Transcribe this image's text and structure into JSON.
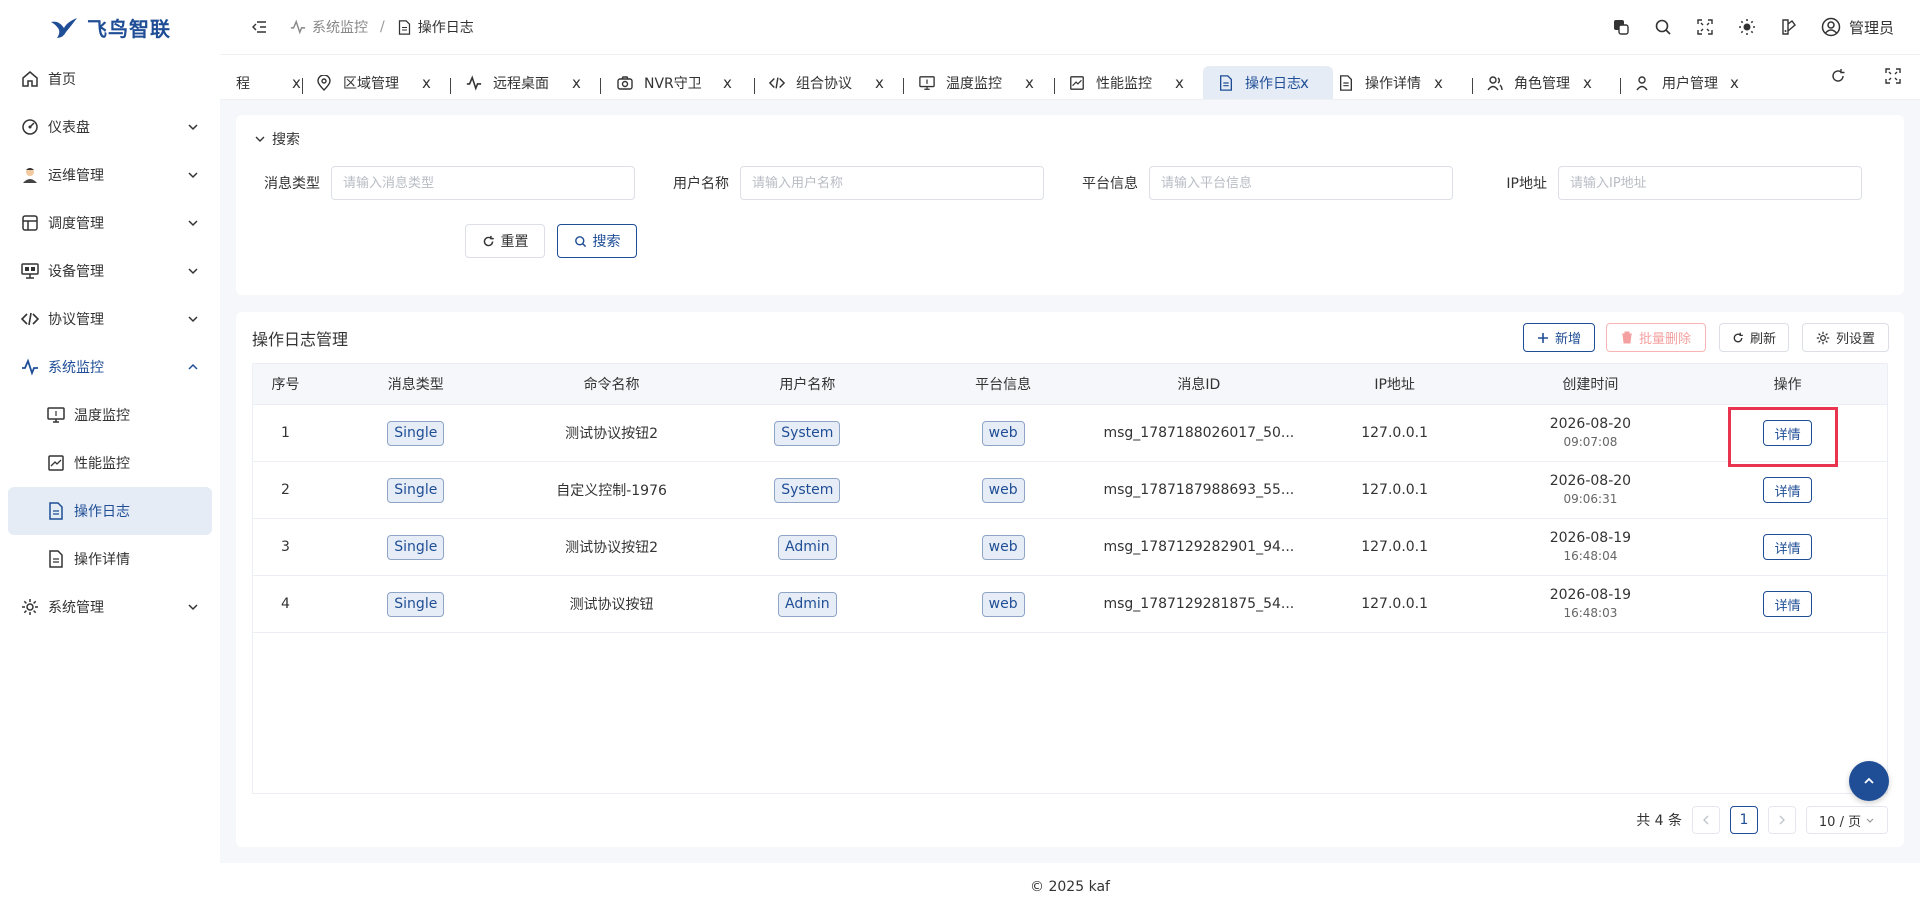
{
  "app": {
    "logo_text": "飞鸟智联",
    "brand_color": "#1f4e96"
  },
  "sidebar": {
    "items": [
      {
        "label": "首页",
        "icon": "home-icon"
      },
      {
        "label": "仪表盘",
        "icon": "dashboard-icon"
      },
      {
        "label": "运维管理",
        "icon": "engineer-avatar-icon"
      },
      {
        "label": "调度管理",
        "icon": "schedule-icon"
      },
      {
        "label": "设备管理",
        "icon": "device-icon"
      },
      {
        "label": "协议管理",
        "icon": "code-icon"
      },
      {
        "label": "系统监控",
        "icon": "pulse-icon",
        "open": true
      },
      {
        "label": "系统管理",
        "icon": "gear-icon"
      }
    ],
    "sub_items": [
      {
        "label": "温度监控",
        "icon": "monitor-icon"
      },
      {
        "label": "性能监控",
        "icon": "chart-icon"
      },
      {
        "label": "操作日志",
        "icon": "document-icon",
        "active": true
      },
      {
        "label": "操作详情",
        "icon": "document-icon"
      }
    ]
  },
  "header": {
    "breadcrumb": [
      "系统监控",
      "操作日志"
    ],
    "user_name": "管理员"
  },
  "tabs": [
    {
      "label": "程",
      "icon": ""
    },
    {
      "label": "区域管理",
      "icon": "location-icon"
    },
    {
      "label": "远程桌面",
      "icon": "pulse-icon"
    },
    {
      "label": "NVR守卫",
      "icon": "camera-icon"
    },
    {
      "label": "组合协议",
      "icon": "code-icon"
    },
    {
      "label": "温度监控",
      "icon": "monitor-icon"
    },
    {
      "label": "性能监控",
      "icon": "chart-icon"
    },
    {
      "label": "操作日志",
      "icon": "document-icon",
      "active": true
    },
    {
      "label": "操作详情",
      "icon": "document-icon"
    },
    {
      "label": "角色管理",
      "icon": "users-icon"
    },
    {
      "label": "用户管理",
      "icon": "user-icon"
    }
  ],
  "tab_close": "x",
  "search": {
    "title": "搜索",
    "fields": [
      {
        "label": "消息类型",
        "placeholder": "请输入消息类型"
      },
      {
        "label": "用户名称",
        "placeholder": "请输入用户名称"
      },
      {
        "label": "平台信息",
        "placeholder": "请输入平台信息"
      },
      {
        "label": "IP地址",
        "placeholder": "请输入IP地址"
      }
    ],
    "reset_label": "重置",
    "search_label": "搜索"
  },
  "table_card": {
    "title": "操作日志管理",
    "add_label": "新增",
    "batch_delete_label": "批量删除",
    "refresh_label": "刷新",
    "columns_label": "列设置"
  },
  "table": {
    "headers": [
      "序号",
      "消息类型",
      "命令名称",
      "用户名称",
      "平台信息",
      "消息ID",
      "IP地址",
      "创建时间",
      "操作"
    ],
    "rows": [
      {
        "index": "1",
        "type": "Single",
        "command": "测试协议按钮2",
        "user": "System",
        "platform": "web",
        "msg_id": "msg_1787188026017_50...",
        "ip": "127.0.0.1",
        "date": "2026-08-20",
        "time": "09:07:08",
        "action": "详情"
      },
      {
        "index": "2",
        "type": "Single",
        "command": "自定义控制-1976",
        "user": "System",
        "platform": "web",
        "msg_id": "msg_1787187988693_55...",
        "ip": "127.0.0.1",
        "date": "2026-08-20",
        "time": "09:06:31",
        "action": "详情"
      },
      {
        "index": "3",
        "type": "Single",
        "command": "测试协议按钮2",
        "user": "Admin",
        "platform": "web",
        "msg_id": "msg_1787129282901_94...",
        "ip": "127.0.0.1",
        "date": "2026-08-19",
        "time": "16:48:04",
        "action": "详情"
      },
      {
        "index": "4",
        "type": "Single",
        "command": "测试协议按钮",
        "user": "Admin",
        "platform": "web",
        "msg_id": "msg_1787129281875_54...",
        "ip": "127.0.0.1",
        "date": "2026-08-19",
        "time": "16:48:03",
        "action": "详情"
      }
    ]
  },
  "pagination": {
    "total_text": "共 4 条",
    "current_page": "1",
    "page_size": "10 / 页"
  },
  "footer": {
    "text": "© 2025 kaf"
  },
  "highlight_color": "#e8344e"
}
